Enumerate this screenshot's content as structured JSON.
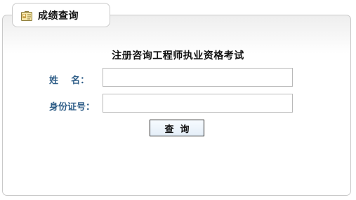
{
  "tab": {
    "title": "成绩查询",
    "icon": "id-card-icon"
  },
  "form": {
    "title": "注册咨询工程师执业资格考试",
    "name_label": "姓    名：",
    "name_value": "",
    "id_label": "身份证号：",
    "id_value": "",
    "query_button": "查  询"
  },
  "colors": {
    "label": "#2f5e88",
    "border": "#c9c9c9",
    "button_bg": "#e4eef8"
  }
}
